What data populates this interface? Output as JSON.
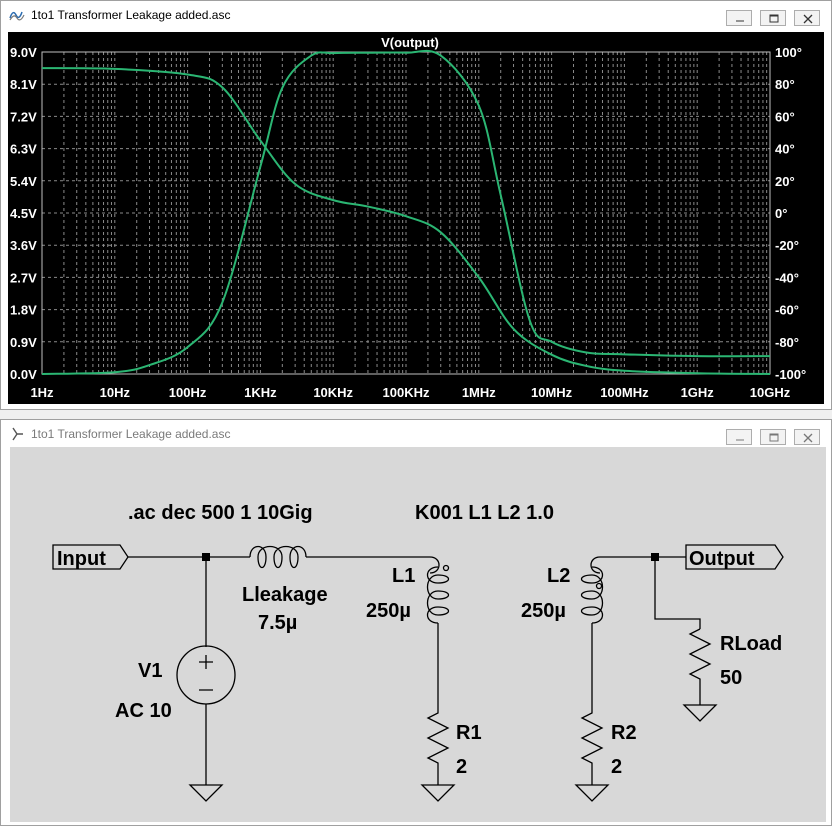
{
  "plot_window": {
    "title": "1to1 Transformer Leakage added.asc",
    "icon": "waveform-icon",
    "controls": [
      "minimize-icon",
      "maximize-icon",
      "close-icon"
    ]
  },
  "schematic_window": {
    "title": "1to1 Transformer Leakage added.asc",
    "icon": "schematic-icon",
    "controls": [
      "minimize-icon",
      "maximize-icon",
      "close-icon"
    ]
  },
  "colors": {
    "plot_bg": "#000000",
    "grid": "#8a8a8a",
    "axis_text": "#ffffff",
    "trace": "#2bb673",
    "schematic_bg": "#d8d8d8",
    "wire": "#000000"
  },
  "chart_data": {
    "type": "line",
    "title": "V(output)",
    "xscale": "log",
    "xlim": [
      1,
      10000000000
    ],
    "x_ticks": [
      "1Hz",
      "10Hz",
      "100Hz",
      "1KHz",
      "10KHz",
      "100KHz",
      "1MHz",
      "10MHz",
      "100MHz",
      "1GHz",
      "10GHz"
    ],
    "y_left": {
      "ticks": [
        "0.0V",
        "0.9V",
        "1.8V",
        "2.7V",
        "3.6V",
        "4.5V",
        "5.4V",
        "6.3V",
        "7.2V",
        "8.1V",
        "9.0V"
      ],
      "ylim": [
        0,
        9
      ]
    },
    "y_right": {
      "ticks": [
        "-100°",
        "-80°",
        "-60°",
        "-40°",
        "-20°",
        "0°",
        "20°",
        "40°",
        "60°",
        "80°",
        "100°"
      ],
      "ylim": [
        -100,
        100
      ]
    },
    "grid": true,
    "series": [
      {
        "axis": "left",
        "x": [
          1,
          10,
          30,
          100,
          300,
          1000,
          2000,
          5000,
          10000,
          30000,
          100000,
          300000,
          1000000,
          2000000,
          5000000,
          10000000,
          30000000,
          100000000,
          1000000000,
          10000000000
        ],
        "y": [
          0.0,
          0.05,
          0.25,
          0.75,
          2.0,
          5.8,
          8.0,
          8.9,
          8.97,
          8.98,
          8.98,
          8.9,
          7.5,
          5.0,
          1.5,
          0.9,
          0.6,
          0.55,
          0.5,
          0.5
        ]
      },
      {
        "axis": "right",
        "x": [
          1,
          10,
          100,
          300,
          1000,
          3000,
          10000,
          30000,
          100000,
          300000,
          1000000,
          3000000,
          10000000,
          30000000,
          100000000,
          1000000000,
          10000000000
        ],
        "y": [
          90,
          89.5,
          86,
          78,
          45,
          18,
          8,
          4,
          -2,
          -12,
          -40,
          -72,
          -88,
          -95,
          -98,
          -99.5,
          -100
        ]
      }
    ]
  },
  "schematic": {
    "directives": {
      "ac": ".ac dec 500 1 10Gig",
      "coupling": "K001 L1 L2 1.0"
    },
    "net_labels": {
      "input": "Input",
      "output": "Output"
    },
    "components": {
      "lleak_name": "Lleakage",
      "lleak_value": "7.5µ",
      "l1_name": "L1",
      "l1_value": "250µ",
      "l2_name": "L2",
      "l2_value": "250µ",
      "v1_name": "V1",
      "v1_value": "AC 10",
      "r1_name": "R1",
      "r1_value": "2",
      "r2_name": "R2",
      "r2_value": "2",
      "rload_name": "RLoad",
      "rload_value": "50"
    }
  }
}
